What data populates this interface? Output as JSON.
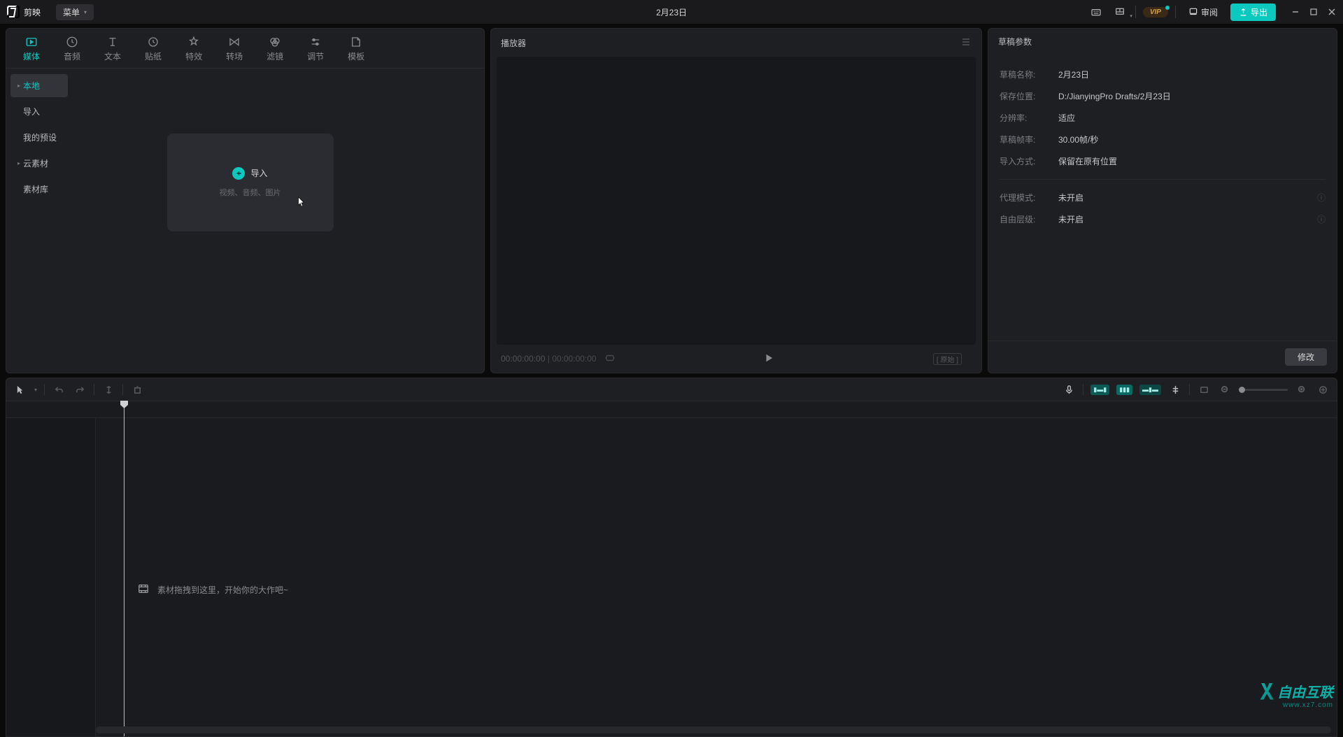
{
  "titlebar": {
    "brand": "剪映",
    "menu": "菜单",
    "project_title": "2月23日",
    "review": "审阅",
    "export": "导出",
    "vip": "VIP"
  },
  "media_tabs": [
    {
      "label": "媒体"
    },
    {
      "label": "音频"
    },
    {
      "label": "文本"
    },
    {
      "label": "贴纸"
    },
    {
      "label": "特效"
    },
    {
      "label": "转场"
    },
    {
      "label": "滤镜"
    },
    {
      "label": "调节"
    },
    {
      "label": "模板"
    }
  ],
  "side_items": {
    "local": "本地",
    "import": "导入",
    "myPresets": "我的预设",
    "cloud": "云素材",
    "library": "素材库"
  },
  "import_box": {
    "title": "导入",
    "sub": "视频、音频、图片"
  },
  "player": {
    "title": "播放器",
    "time_current": "00:00:00:00",
    "time_total": "00:00:00:00"
  },
  "params": {
    "title": "草稿参数",
    "name_label": "草稿名称:",
    "name_value": "2月23日",
    "path_label": "保存位置:",
    "path_value": "D:/JianyingPro Drafts/2月23日",
    "res_label": "分辨率:",
    "res_value": "适应",
    "fps_label": "草稿帧率:",
    "fps_value": "30.00帧/秒",
    "import_label": "导入方式:",
    "import_value": "保留在原有位置",
    "proxy_label": "代理模式:",
    "proxy_value": "未开启",
    "layer_label": "自由层级:",
    "layer_value": "未开启",
    "modify": "修改"
  },
  "timeline": {
    "hint": "素材拖拽到这里，开始你的大作吧~"
  },
  "watermark": {
    "text": "自由互联",
    "url": "www.xz7.com"
  }
}
